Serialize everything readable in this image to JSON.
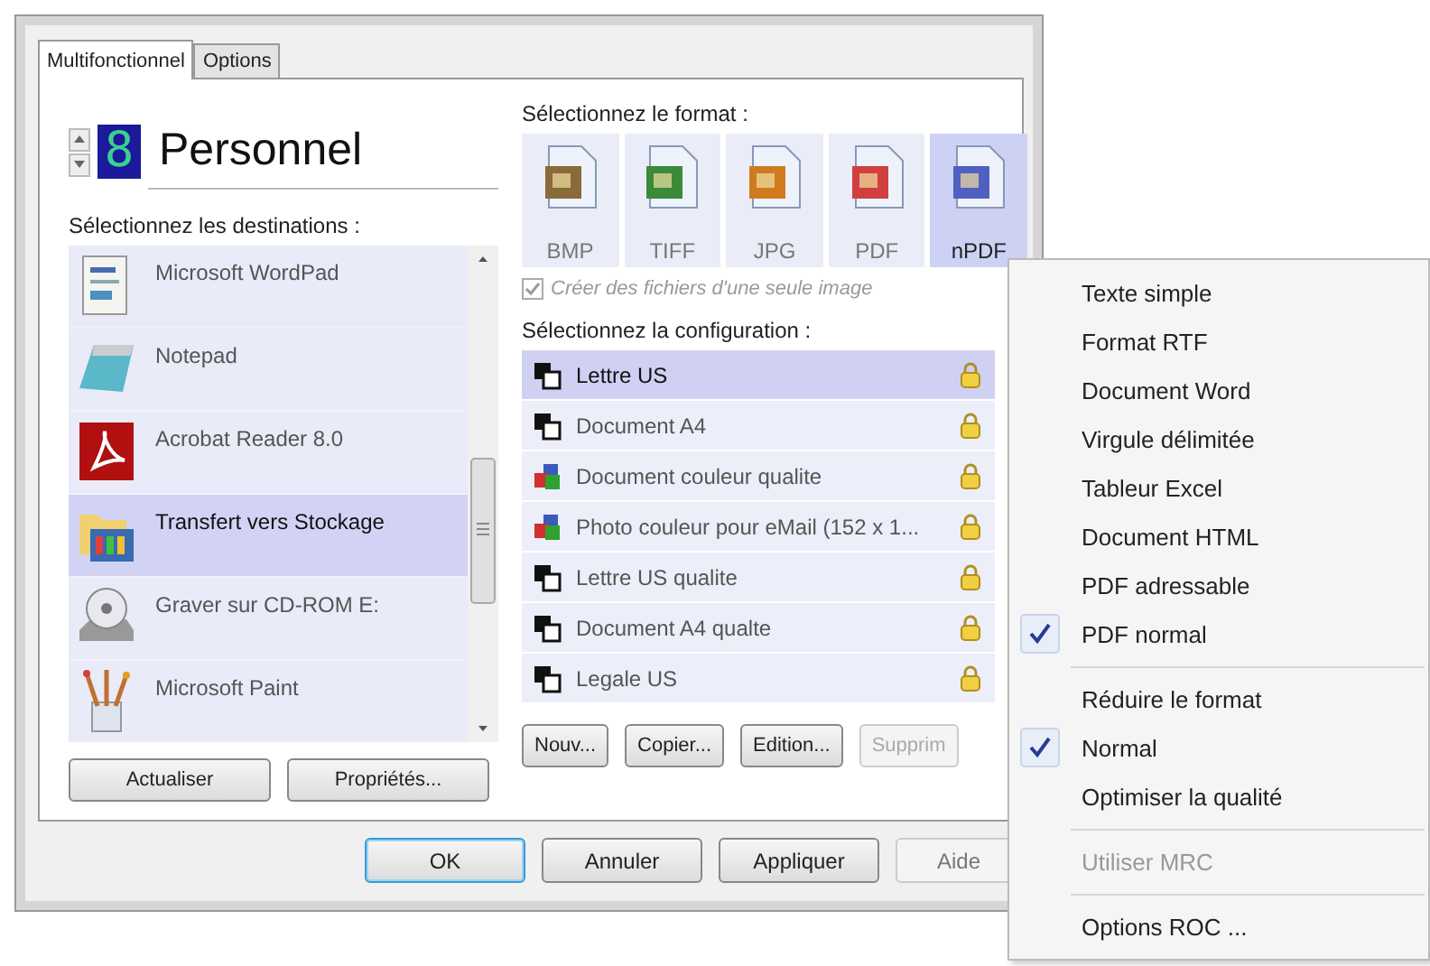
{
  "tabs": [
    {
      "label": "Multifonctionnel",
      "selected": true
    },
    {
      "label": "Options",
      "selected": false
    }
  ],
  "profile": {
    "number": "8",
    "name": "Personnel"
  },
  "destinations": {
    "label": "Sélectionnez les destinations :",
    "items": [
      {
        "name": "Microsoft WordPad",
        "selected": false
      },
      {
        "name": "Notepad",
        "selected": false
      },
      {
        "name": "Acrobat Reader 8.0",
        "selected": false
      },
      {
        "name": "Transfert vers Stockage",
        "selected": true
      },
      {
        "name": "Graver sur CD-ROM  E:",
        "selected": false
      },
      {
        "name": "Microsoft Paint",
        "selected": false
      }
    ]
  },
  "left_buttons": [
    "Actualiser",
    "Propriétés..."
  ],
  "format": {
    "label": "Sélectionnez le format :",
    "items": [
      {
        "label": "BMP",
        "selected": false
      },
      {
        "label": "TIFF",
        "selected": false
      },
      {
        "label": "JPG",
        "selected": false
      },
      {
        "label": "PDF",
        "selected": false
      },
      {
        "label": "nPDF",
        "selected": true
      }
    ]
  },
  "single_image": {
    "label": "Créer des fichiers d'une seule image",
    "checked": true,
    "disabled": true
  },
  "configuration": {
    "label": "Sélectionnez la configuration :",
    "items": [
      {
        "name": "Lettre US",
        "kind": "mono",
        "selected": true
      },
      {
        "name": "Document A4",
        "kind": "mono",
        "selected": false
      },
      {
        "name": "Document couleur qualite",
        "kind": "color",
        "selected": false
      },
      {
        "name": "Photo couleur pour eMail (152 x 1...",
        "kind": "color",
        "selected": false
      },
      {
        "name": "Lettre US qualite",
        "kind": "mono",
        "selected": false
      },
      {
        "name": "Document A4 qualte",
        "kind": "mono",
        "selected": false
      },
      {
        "name": "Legale US",
        "kind": "mono",
        "selected": false
      }
    ]
  },
  "config_buttons": [
    {
      "label": "Nouv...",
      "disabled": false
    },
    {
      "label": "Copier...",
      "disabled": false
    },
    {
      "label": "Edition...",
      "disabled": false
    },
    {
      "label": "Supprim",
      "disabled": true
    }
  ],
  "dialog_buttons": [
    {
      "label": "OK",
      "default": true,
      "disabled": false
    },
    {
      "label": "Annuler",
      "default": false,
      "disabled": false
    },
    {
      "label": "Appliquer",
      "default": false,
      "disabled": false
    },
    {
      "label": "Aide",
      "default": false,
      "disabled": true
    }
  ],
  "menu": {
    "groups": [
      [
        {
          "label": "Texte simple",
          "checked": false,
          "disabled": false
        },
        {
          "label": "Format RTF",
          "checked": false,
          "disabled": false
        },
        {
          "label": "Document Word",
          "checked": false,
          "disabled": false
        },
        {
          "label": "Virgule délimitée",
          "checked": false,
          "disabled": false
        },
        {
          "label": "Tableur Excel",
          "checked": false,
          "disabled": false
        },
        {
          "label": "Document HTML",
          "checked": false,
          "disabled": false
        },
        {
          "label": "PDF adressable",
          "checked": false,
          "disabled": false
        },
        {
          "label": "PDF normal",
          "checked": true,
          "disabled": false
        }
      ],
      [
        {
          "label": "Réduire le format",
          "checked": false,
          "disabled": false
        },
        {
          "label": "Normal",
          "checked": true,
          "disabled": false
        },
        {
          "label": "Optimiser la qualité",
          "checked": false,
          "disabled": false
        }
      ],
      [
        {
          "label": "Utiliser MRC",
          "checked": false,
          "disabled": true
        }
      ],
      [
        {
          "label": "Options ROC ...",
          "checked": false,
          "disabled": false
        }
      ]
    ]
  }
}
